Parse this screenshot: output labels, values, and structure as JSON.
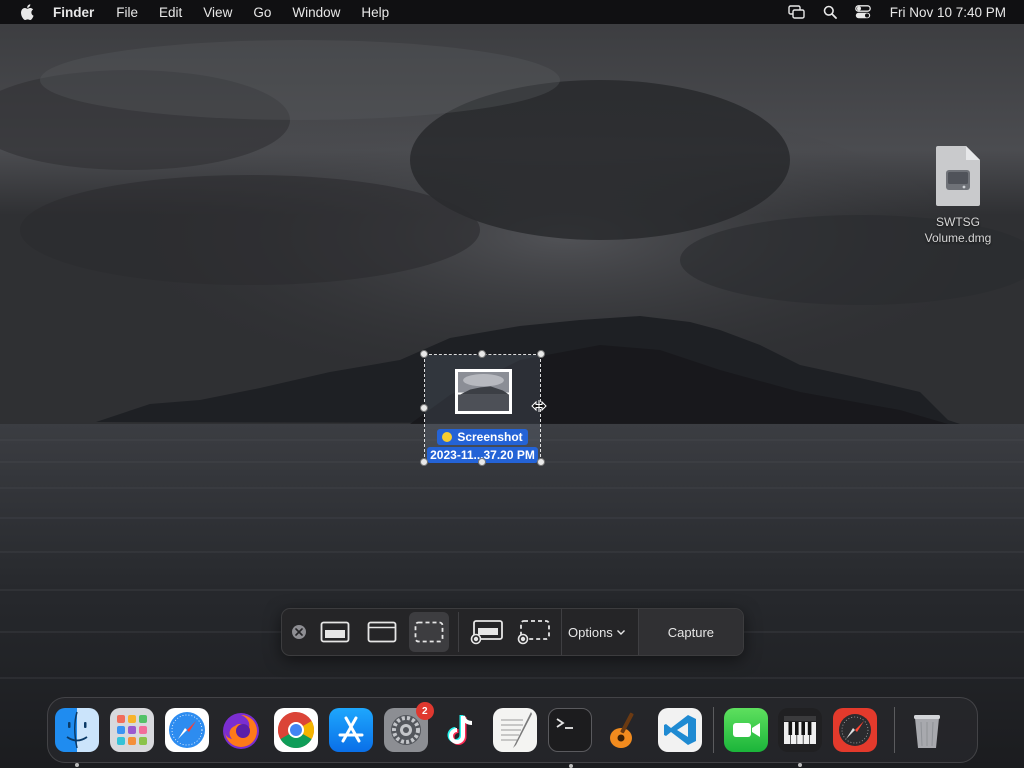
{
  "menubar": {
    "app_name": "Finder",
    "menus": [
      "File",
      "Edit",
      "View",
      "Go",
      "Window",
      "Help"
    ],
    "clock": "Fri Nov 10  7:40 PM",
    "status_icons": [
      "screen-mirroring-icon",
      "spotlight-search-icon",
      "control-center-icon"
    ]
  },
  "desktop": {
    "file_icon": {
      "name_line1": "SWTSG",
      "name_line2": "Volume.dmg",
      "icon": "disk-image-icon"
    }
  },
  "floating_thumbnail": {
    "title": "Screenshot",
    "subtitle": "2023-11...37.20 PM",
    "tag_color": "#f7cd2f"
  },
  "toolbar": {
    "tools": [
      {
        "icon": "close-icon",
        "name": "close"
      },
      {
        "icon": "capture-entire-screen-icon",
        "name": "capture-entire-screen"
      },
      {
        "icon": "capture-window-icon",
        "name": "capture-window"
      },
      {
        "icon": "capture-selection-icon",
        "name": "capture-selection",
        "active": true
      },
      {
        "icon": "record-entire-screen-icon",
        "name": "record-entire-screen"
      },
      {
        "icon": "record-selection-icon",
        "name": "record-selection"
      }
    ],
    "options_label": "Options",
    "capture_label": "Capture"
  },
  "dock": {
    "apps": [
      {
        "name": "Finder",
        "icon": "finder-icon",
        "running": true
      },
      {
        "name": "Launchpad",
        "icon": "launchpad-icon"
      },
      {
        "name": "Safari",
        "icon": "safari-icon"
      },
      {
        "name": "Firefox",
        "icon": "firefox-icon"
      },
      {
        "name": "Google Chrome",
        "icon": "chrome-icon"
      },
      {
        "name": "App Store",
        "icon": "app-store-icon"
      },
      {
        "name": "System Settings",
        "icon": "system-settings-icon",
        "badge": "2"
      },
      {
        "name": "TikTok",
        "icon": "tiktok-icon"
      },
      {
        "name": "TextEdit",
        "icon": "textedit-icon"
      },
      {
        "name": "Terminal",
        "icon": "terminal-icon",
        "running": true
      },
      {
        "name": "GarageBand",
        "icon": "garageband-icon"
      },
      {
        "name": "Visual Studio Code",
        "icon": "vscode-icon"
      },
      {
        "name": "FaceTime",
        "icon": "facetime-icon"
      },
      {
        "name": "Piano",
        "icon": "piano-icon",
        "running": true
      },
      {
        "name": "Compass",
        "icon": "compass-icon"
      },
      {
        "name": "Trash",
        "icon": "trash-icon"
      }
    ]
  },
  "colors": {
    "menubar_bg": "#101012",
    "selection_label_bg": "#2463d6",
    "badge_red": "#e0382f"
  }
}
